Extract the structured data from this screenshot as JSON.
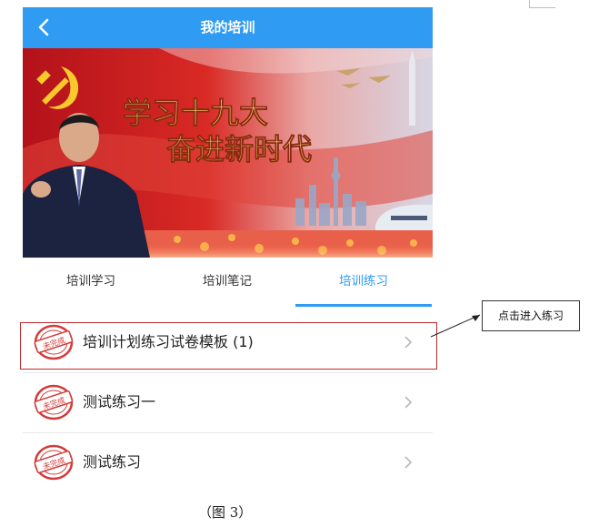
{
  "header": {
    "title": "我的培训",
    "back_icon": "chevron-left-icon"
  },
  "banner": {
    "line1": "学习十九大",
    "line2": "奋进新时代"
  },
  "tabs": [
    {
      "label": "培训学习",
      "active": false
    },
    {
      "label": "培训笔记",
      "active": false
    },
    {
      "label": "培训练习",
      "active": true
    }
  ],
  "list": {
    "items": [
      {
        "label": "培训计划练习试卷模板 (1)",
        "badge": "未完成"
      },
      {
        "label": "测试练习一",
        "badge": "未完成"
      },
      {
        "label": "测试练习",
        "badge": "未完成"
      }
    ]
  },
  "annotation": {
    "callout": "点击进入练习"
  },
  "caption": "（图 3）",
  "colors": {
    "primary": "#2f9bf3",
    "stamp": "#d33a3a",
    "highlight_border": "#c0282a"
  }
}
